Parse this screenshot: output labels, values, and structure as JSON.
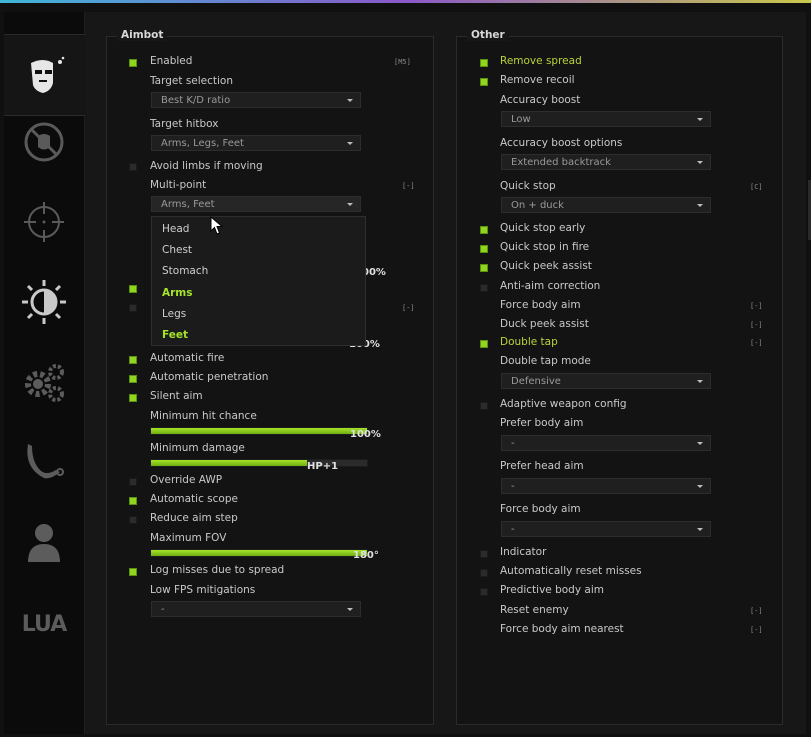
{
  "tabs": [
    {
      "name": "ragebot",
      "icon": "terrorist-head-icon",
      "active": true
    },
    {
      "name": "anti-aim",
      "icon": "no-symbol-icon",
      "active": false
    },
    {
      "name": "legitbot",
      "icon": "crosshair-icon",
      "active": false
    },
    {
      "name": "visuals",
      "icon": "brightness-icon",
      "active": false
    },
    {
      "name": "misc",
      "icon": "gears-icon",
      "active": false
    },
    {
      "name": "skins",
      "icon": "karambit-icon",
      "active": false
    },
    {
      "name": "players",
      "icon": "person-icon",
      "active": false
    },
    {
      "name": "lua",
      "label": "LUA",
      "active": false
    }
  ],
  "colors": {
    "accent": "#8fd61d",
    "highlight": "#b8d43a",
    "background": "#131313"
  },
  "aimbot": {
    "title": "Aimbot",
    "enabled": {
      "label": "Enabled",
      "key": "[M5]",
      "checked": true
    },
    "target_selection": {
      "label": "Target selection",
      "value": "Best K/D ratio"
    },
    "target_hitbox": {
      "label": "Target hitbox",
      "value": "Arms, Legs, Feet"
    },
    "avoid_limbs": {
      "label": "Avoid limbs if moving",
      "checked": false
    },
    "multipoint": {
      "label": "Multi-point",
      "key": "[-]",
      "value": "Arms, Feet",
      "options": [
        "Head",
        "Chest",
        "Stomach",
        "Arms",
        "Legs",
        "Feet"
      ],
      "selected": [
        "Arms",
        "Feet"
      ],
      "hidden_value_1": "00%",
      "hidden_value_2": "100%"
    },
    "auto_fire": {
      "label": "Automatic fire",
      "checked": true
    },
    "auto_penetration": {
      "label": "Automatic penetration",
      "checked": true
    },
    "silent_aim": {
      "label": "Silent aim",
      "checked": true
    },
    "min_hit_chance": {
      "label": "Minimum hit chance",
      "value": "100%",
      "level": 1.0
    },
    "min_damage": {
      "label": "Minimum damage",
      "value": "HP+1",
      "level": 0.72
    },
    "override_awp": {
      "label": "Override AWP",
      "checked": false
    },
    "auto_scope": {
      "label": "Automatic scope",
      "checked": true
    },
    "reduce_aim_step": {
      "label": "Reduce aim step",
      "checked": false
    },
    "max_fov": {
      "label": "Maximum FOV",
      "value": "180°",
      "level": 1.0
    },
    "log_misses": {
      "label": "Log misses due to spread",
      "checked": true
    },
    "low_fps": {
      "label": "Low FPS mitigations",
      "value": "-"
    }
  },
  "other": {
    "title": "Other",
    "remove_spread": {
      "label": "Remove spread",
      "checked": true
    },
    "remove_recoil": {
      "label": "Remove recoil",
      "checked": true
    },
    "accuracy_boost": {
      "label": "Accuracy boost",
      "value": "Low"
    },
    "accuracy_boost_options": {
      "label": "Accuracy boost options",
      "value": "Extended backtrack"
    },
    "quick_stop": {
      "label": "Quick stop",
      "key": "[C]",
      "value": "On + duck"
    },
    "quick_stop_early": {
      "label": "Quick stop early",
      "checked": true
    },
    "quick_stop_in_fire": {
      "label": "Quick stop in fire",
      "checked": true
    },
    "quick_peek_assist": {
      "label": "Quick peek assist",
      "checked": true
    },
    "anti_aim_correction": {
      "label": "Anti-aim correction",
      "checked": false
    },
    "force_body_aim": {
      "label": "Force body aim",
      "key": "[-]"
    },
    "duck_peek_assist": {
      "label": "Duck peek assist",
      "key": "[-]"
    },
    "double_tap": {
      "label": "Double tap",
      "key": "[-]",
      "checked": true
    },
    "double_tap_mode": {
      "label": "Double tap mode",
      "value": "Defensive"
    },
    "adaptive_weapon_config": {
      "label": "Adaptive weapon config",
      "checked": false
    },
    "prefer_body_aim": {
      "label": "Prefer body aim",
      "value": "-"
    },
    "prefer_head_aim": {
      "label": "Prefer head aim",
      "value": "-"
    },
    "force_body_aim_dd": {
      "label": "Force body aim",
      "value": "-"
    },
    "indicator": {
      "label": "Indicator",
      "checked": false
    },
    "auto_reset_misses": {
      "label": "Automatically reset misses",
      "checked": false
    },
    "predictive_body_aim": {
      "label": "Predictive body aim",
      "checked": false
    },
    "reset_enemy": {
      "label": "Reset enemy",
      "key": "[-]"
    },
    "force_body_aim_nearest": {
      "label": "Force body aim nearest",
      "key": "[-]"
    }
  }
}
